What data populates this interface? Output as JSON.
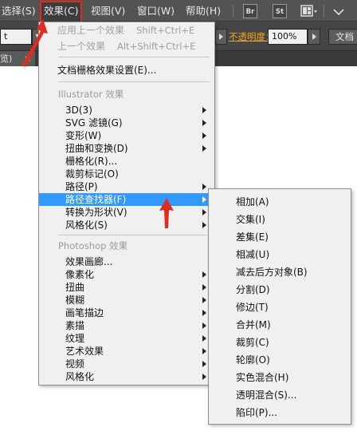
{
  "menubar": {
    "items": [
      "选择(S)",
      "效果(C)",
      "视图(V)",
      "窗口(W)",
      "帮助(H)"
    ],
    "app_buttons": [
      "Br",
      "St"
    ]
  },
  "control_bar": {
    "left_field": "t",
    "opacity_label": "不透明度：",
    "opacity_value": "100%",
    "right_button": "文档"
  },
  "tab_bar": {
    "tab_label": "览)",
    "close": "×"
  },
  "effect_menu": {
    "apply_last": {
      "label": "应用上一个效果",
      "shortcut": "Shift+Ctrl+E"
    },
    "last_effect": {
      "label": "上一个效果",
      "shortcut": "Alt+Shift+Ctrl+E"
    },
    "doc_raster": "文档栅格效果设置(E)...",
    "illustrator_header": "Illustrator 效果",
    "illustrator_items": [
      "3D(3)",
      "SVG 滤镜(G)",
      "变形(W)",
      "扭曲和变换(D)",
      "栅格化(R)...",
      "裁剪标记(O)",
      "路径(P)",
      "路径查找器(F)",
      "转换为形状(V)",
      "风格化(S)"
    ],
    "photoshop_header": "Photoshop 效果",
    "photoshop_items": [
      "效果画廊...",
      "像素化",
      "扭曲",
      "模糊",
      "画笔描边",
      "素描",
      "纹理",
      "艺术效果",
      "视频",
      "风格化"
    ]
  },
  "pathfinder_submenu": {
    "items": [
      "相加(A)",
      "交集(I)",
      "差集(E)",
      "相减(U)",
      "减去后方对象(B)",
      "分割(D)",
      "修边(T)",
      "合并(M)",
      "裁剪(C)",
      "轮廓(O)",
      "实色混合(H)",
      "透明混合(S)...",
      "陷印(P)..."
    ]
  },
  "colors": {
    "highlight": "#3399ff",
    "annotation_red": "#e02b1f",
    "opacity_label": "#f5a623"
  }
}
